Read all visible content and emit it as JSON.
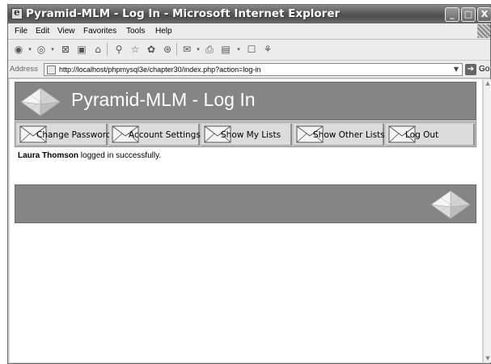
{
  "window": {
    "title": "Pyramid-MLM - Log In - Microsoft Internet Explorer",
    "minimize": "_",
    "maximize": "□",
    "close": "X"
  },
  "menu": {
    "items": [
      "File",
      "Edit",
      "View",
      "Favorites",
      "Tools",
      "Help"
    ]
  },
  "toolbar": {
    "icons": [
      "back-icon",
      "forward-icon",
      "stop-icon",
      "refresh-icon",
      "home-icon",
      "search-icon",
      "favorites-icon",
      "media-icon",
      "history-icon",
      "mail-icon",
      "print-icon",
      "edit-icon",
      "discuss-icon",
      "messenger-icon"
    ]
  },
  "address": {
    "label": "Address",
    "url": "http://localhost/phpmysql3e/chapter30/index.php?action=log-in",
    "go_label": "Go"
  },
  "page": {
    "header_title": "Pyramid-MLM - Log In",
    "nav": [
      "Change Password",
      "Account Settings",
      "Show My Lists",
      "Show Other Lists",
      "Log Out"
    ],
    "message_user": "Laura Thomson",
    "message_text": " logged in successfully."
  },
  "colors": {
    "header_bg": "#858585",
    "nav_bg": "#c8c8c8",
    "titlebar": "#5a5a5a"
  }
}
